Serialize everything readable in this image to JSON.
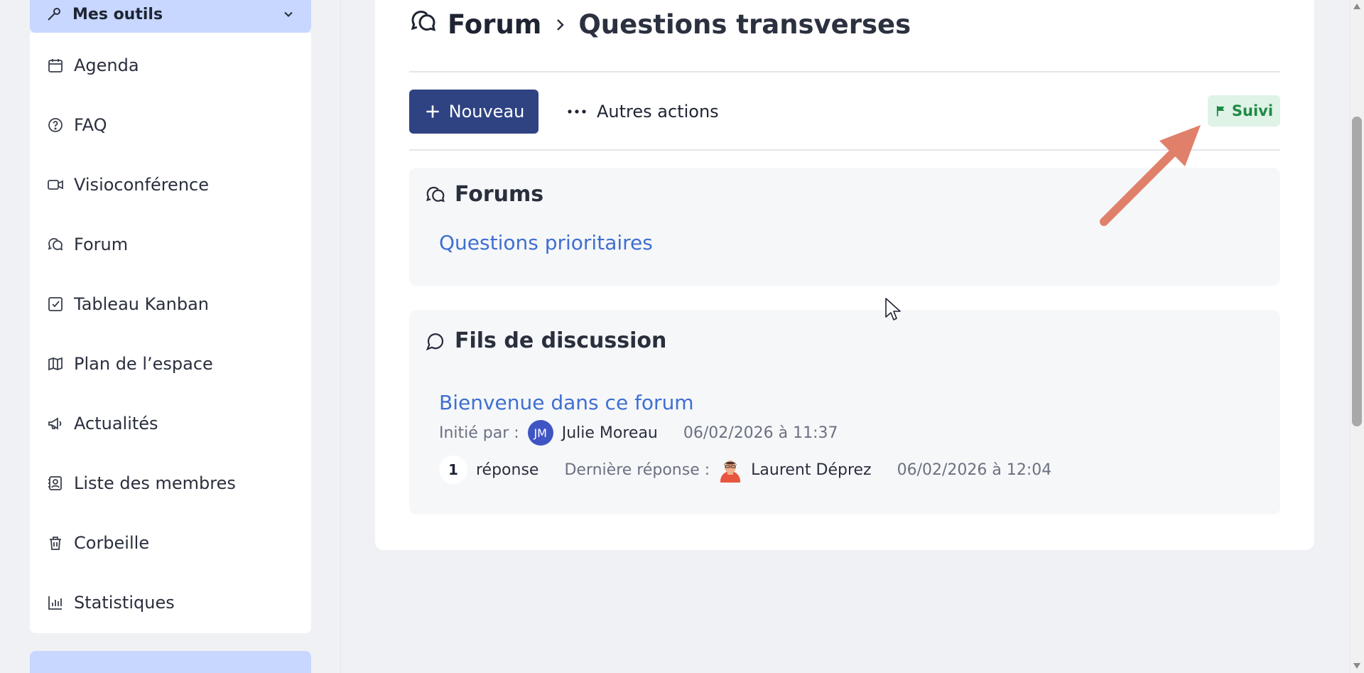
{
  "sidebar": {
    "section_title": "Mes outils",
    "items": [
      {
        "label": "Agenda",
        "icon": "calendar-icon"
      },
      {
        "label": "FAQ",
        "icon": "question-icon"
      },
      {
        "label": "Visioconférence",
        "icon": "video-icon"
      },
      {
        "label": "Forum",
        "icon": "forum-icon"
      },
      {
        "label": "Tableau Kanban",
        "icon": "checkbox-icon"
      },
      {
        "label": "Plan de l’espace",
        "icon": "map-icon"
      },
      {
        "label": "Actualités",
        "icon": "megaphone-icon"
      },
      {
        "label": "Liste des membres",
        "icon": "members-icon"
      },
      {
        "label": "Corbeille",
        "icon": "trash-icon"
      },
      {
        "label": "Statistiques",
        "icon": "stats-icon"
      }
    ]
  },
  "breadcrumb": {
    "root": "Forum",
    "current": "Questions transverses"
  },
  "toolbar": {
    "new_label": "Nouveau",
    "more_label": "Autres actions",
    "follow_label": "Suivi"
  },
  "forums": {
    "title": "Forums",
    "items": [
      {
        "label": "Questions prioritaires"
      }
    ]
  },
  "threads": {
    "title": "Fils de discussion",
    "items": [
      {
        "title": "Bienvenue dans ce forum",
        "started_by_label": "Initié par :",
        "author_initials": "JM",
        "author": "Julie Moreau",
        "started_at": "06/02/2026 à 11:37",
        "reply_count": "1",
        "reply_label": "réponse",
        "last_reply_label": "Dernière réponse :",
        "last_reply_author": "Laurent Déprez",
        "last_reply_at": "06/02/2026 à 12:04"
      }
    ]
  },
  "colors": {
    "primary": "#2f4383",
    "link": "#3f6fd0",
    "follow_badge_bg": "#dff3e6",
    "follow_badge_text": "#1e8a45",
    "annotation_arrow": "#e0806a"
  }
}
